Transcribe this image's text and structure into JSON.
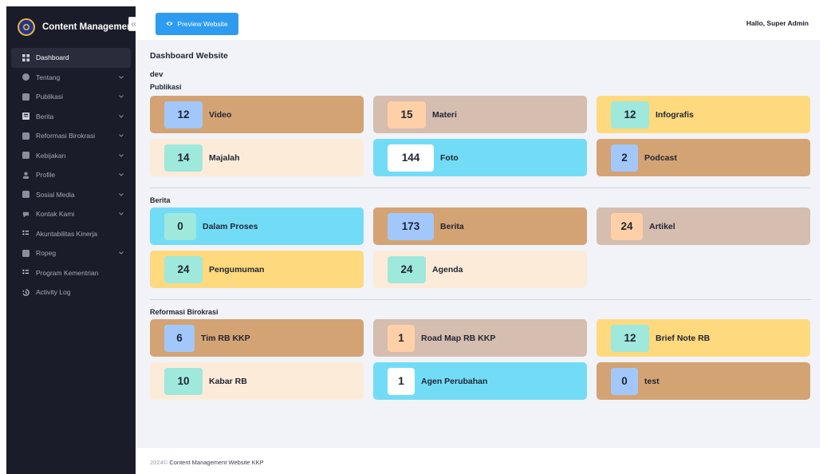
{
  "brand": {
    "title": "Content Management"
  },
  "sidebar": {
    "items": [
      {
        "label": "Dashboard",
        "icon": "dashboard-icon",
        "active": true,
        "chevron": false
      },
      {
        "label": "Tentang",
        "icon": "info-icon",
        "chevron": true
      },
      {
        "label": "Publikasi",
        "icon": "publication-icon",
        "chevron": true
      },
      {
        "label": "Berita",
        "icon": "newspaper-icon",
        "chevron": true
      },
      {
        "label": "Reformasi Birokrasi",
        "icon": "document-icon",
        "chevron": true
      },
      {
        "label": "Kebijakan",
        "icon": "document-icon",
        "chevron": true
      },
      {
        "label": "Profile",
        "icon": "user-icon",
        "chevron": true
      },
      {
        "label": "Sosial Media",
        "icon": "social-icon",
        "chevron": true
      },
      {
        "label": "Kontak Kami",
        "icon": "contact-icon",
        "chevron": true
      },
      {
        "label": "Akuntabilitas Kinerja",
        "icon": "list-icon",
        "chevron": false
      },
      {
        "label": "Ropeg",
        "icon": "document-icon",
        "chevron": true
      },
      {
        "label": "Program Kementrian",
        "icon": "list-icon",
        "chevron": false
      },
      {
        "label": "Activity Log",
        "icon": "history-icon",
        "chevron": false
      }
    ]
  },
  "topbar": {
    "preview_label": "Preview Website",
    "greeting": "Hallo, Super Admin"
  },
  "main": {
    "title": "Dashboard Website",
    "env": "dev",
    "publikasi": {
      "title": "Publikasi",
      "cards": [
        {
          "count": "12",
          "label": "Video"
        },
        {
          "count": "15",
          "label": "Materi"
        },
        {
          "count": "12",
          "label": "Infografis"
        },
        {
          "count": "14",
          "label": "Majalah"
        },
        {
          "count": "144",
          "label": "Foto"
        },
        {
          "count": "2",
          "label": "Podcast"
        }
      ]
    },
    "berita": {
      "title": "Berita",
      "cards": [
        {
          "count": "0",
          "label": "Dalam Proses"
        },
        {
          "count": "173",
          "label": "Berita"
        },
        {
          "count": "24",
          "label": "Artikel"
        },
        {
          "count": "24",
          "label": "Pengumuman"
        },
        {
          "count": "24",
          "label": "Agenda"
        }
      ]
    },
    "reformasi": {
      "title": "Reformasi Birokrasi",
      "cards": [
        {
          "count": "6",
          "label": "Tim RB KKP"
        },
        {
          "count": "1",
          "label": "Road Map RB KKP"
        },
        {
          "count": "12",
          "label": "Brief Note RB"
        },
        {
          "count": "10",
          "label": "Kabar RB"
        },
        {
          "count": "1",
          "label": "Agen Perubahan"
        },
        {
          "count": "0",
          "label": "test"
        }
      ]
    }
  },
  "footer": {
    "year": "2024©",
    "text": "Content Management Website KKP"
  },
  "colors": {
    "sidebar_bg": "#1b1c29",
    "accent_blue": "#2d9bf0",
    "card_brown": "#d4a373",
    "card_taupe": "#d5bdaf",
    "card_yellow": "#ffd97d",
    "card_cream": "#fdebd9",
    "card_cyan": "#72dcf6"
  }
}
